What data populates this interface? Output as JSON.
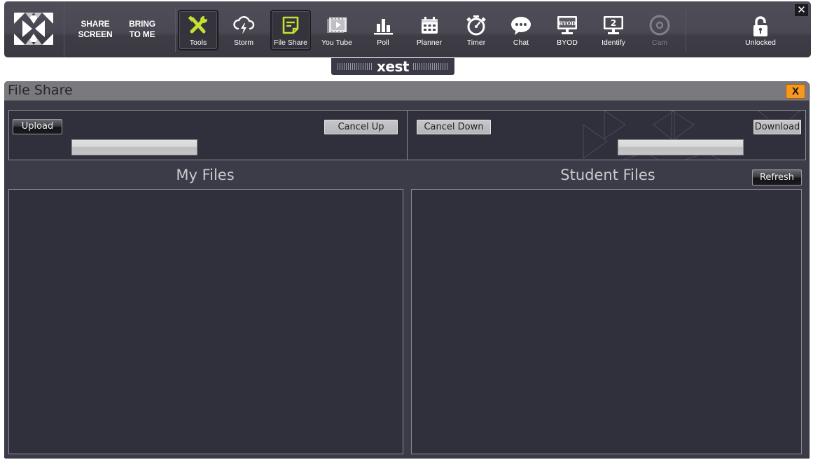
{
  "toolbar": {
    "logo": "xest-x-logo",
    "share_screen": [
      "SHARE",
      "SCREEN"
    ],
    "bring_to_me": [
      "BRING",
      "TO ME"
    ],
    "items": [
      {
        "label": "Tools",
        "icon": "tools-icon",
        "active": true,
        "color": "#c6e033"
      },
      {
        "label": "Storm",
        "icon": "storm-cloud-icon",
        "active": false
      },
      {
        "label": "File Share",
        "icon": "file-share-note-icon",
        "active": true,
        "color": "#c6e033"
      },
      {
        "label": "You Tube",
        "icon": "youtube-video-icon",
        "active": false
      },
      {
        "label": "Poll",
        "icon": "poll-bar-chart-icon",
        "active": false
      },
      {
        "label": "Planner",
        "icon": "calendar-icon",
        "active": false
      },
      {
        "label": "Timer",
        "icon": "stopwatch-icon",
        "active": false
      },
      {
        "label": "Chat",
        "icon": "chat-bubble-icon",
        "active": false
      },
      {
        "label": "BYOD",
        "icon": "byod-monitor-icon",
        "active": false,
        "screen_text": "BYOD"
      },
      {
        "label": "Identify",
        "icon": "identify-monitor-icon",
        "active": false,
        "screen_text": "2"
      },
      {
        "label": "Cam",
        "icon": "camera-icon",
        "active": false,
        "disabled": true
      }
    ],
    "lock": {
      "label": "Unlocked",
      "icon": "unlocked-padlock-icon"
    },
    "close_glyph": "✕"
  },
  "brand": {
    "word": "xest"
  },
  "window": {
    "title": "File Share",
    "close_label": "X",
    "upload_label": "Upload",
    "cancel_up_label": "Cancel Up",
    "cancel_down_label": "Cancel Down",
    "download_label": "Download",
    "upload_progress": 0,
    "download_progress": 0,
    "my_files_title": "My Files",
    "student_files_title": "Student Files",
    "refresh_label": "Refresh",
    "my_files": [],
    "student_files": []
  },
  "colors": {
    "accent_active": "#c6e033",
    "close_button": "#f5981d",
    "panel_bg": "#2f303b",
    "window_bg": "#3b3c47",
    "toolbar_bg": "#4a4953"
  }
}
